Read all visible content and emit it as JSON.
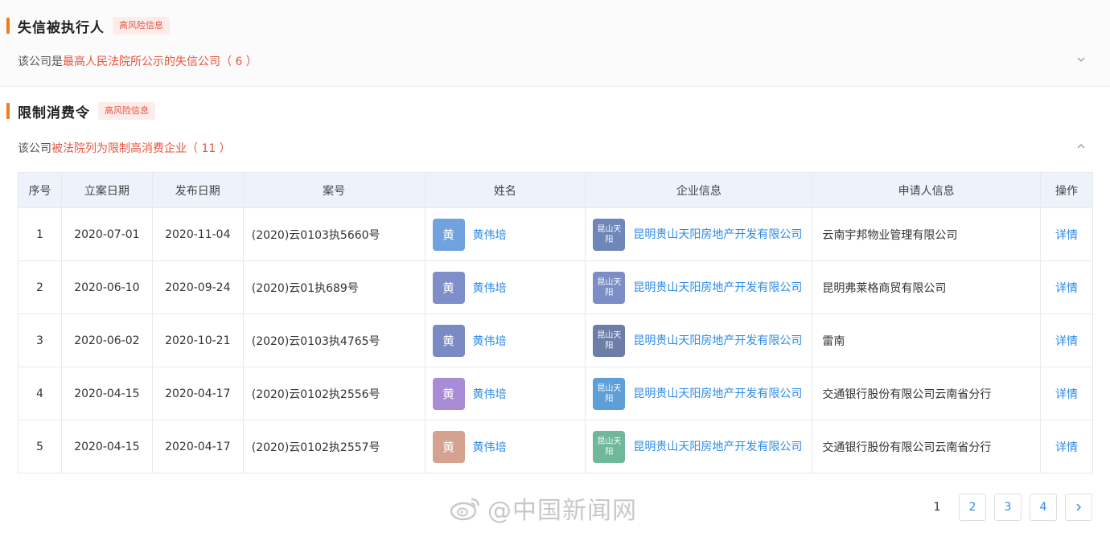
{
  "sections": {
    "dishonest": {
      "title": "失信被执行人",
      "risk_tag": "高风险信息",
      "desc_prefix": "该公司是",
      "desc_highlight": "最高人民法院所公示的失信公司",
      "desc_count": "（ 6 ）"
    },
    "restriction": {
      "title": "限制消费令",
      "risk_tag": "高风险信息",
      "desc_prefix": "该公司",
      "desc_highlight": "被法院列为限制高消费企业",
      "desc_count": "（ 11 ）"
    }
  },
  "table": {
    "headers": [
      "序号",
      "立案日期",
      "发布日期",
      "案号",
      "姓名",
      "企业信息",
      "申请人信息",
      "操作"
    ],
    "rows": [
      {
        "idx": "1",
        "filed": "2020-07-01",
        "published": "2020-11-04",
        "case_no": "(2020)云0103执5660号",
        "avatar_char": "黄",
        "avatar_color": "#6fa2de",
        "person": "黄伟培",
        "ent_avatar": "昆山天阳",
        "ent_color": "#6f86b8",
        "enterprise": "昆明贵山天阳房地产开发有限公司",
        "applicant": "云南宇邦物业管理有限公司",
        "action": "详情"
      },
      {
        "idx": "2",
        "filed": "2020-06-10",
        "published": "2020-09-24",
        "case_no": "(2020)云01执689号",
        "avatar_char": "黄",
        "avatar_color": "#7e8ec8",
        "person": "黄伟培",
        "ent_avatar": "昆山天阳",
        "ent_color": "#7b8ec6",
        "enterprise": "昆明贵山天阳房地产开发有限公司",
        "applicant": "昆明弗莱格商贸有限公司",
        "action": "详情"
      },
      {
        "idx": "3",
        "filed": "2020-06-02",
        "published": "2020-10-21",
        "case_no": "(2020)云0103执4765号",
        "avatar_char": "黄",
        "avatar_color": "#7a8bc4",
        "person": "黄伟培",
        "ent_avatar": "昆山天阳",
        "ent_color": "#6c7ea8",
        "enterprise": "昆明贵山天阳房地产开发有限公司",
        "applicant": "雷南",
        "action": "详情"
      },
      {
        "idx": "4",
        "filed": "2020-04-15",
        "published": "2020-04-17",
        "case_no": "(2020)云0102执2556号",
        "avatar_char": "黄",
        "avatar_color": "#a98bd6",
        "person": "黄伟培",
        "ent_avatar": "昆山天阳",
        "ent_color": "#5d9fd6",
        "enterprise": "昆明贵山天阳房地产开发有限公司",
        "applicant": "交通银行股份有限公司云南省分行",
        "action": "详情"
      },
      {
        "idx": "5",
        "filed": "2020-04-15",
        "published": "2020-04-17",
        "case_no": "(2020)云0102执2557号",
        "avatar_char": "黄",
        "avatar_color": "#d4a28e",
        "person": "黄伟培",
        "ent_avatar": "昆山天阳",
        "ent_color": "#6fb89a",
        "enterprise": "昆明贵山天阳房地产开发有限公司",
        "applicant": "交通银行股份有限公司云南省分行",
        "action": "详情"
      }
    ]
  },
  "watermark": "@中国新闻网",
  "pagination": {
    "pages": [
      "1",
      "2",
      "3",
      "4"
    ],
    "current": "1",
    "next": "›"
  },
  "icons": {
    "chevron_down": "chevron-down-icon",
    "chevron_up": "chevron-up-icon",
    "weibo": "weibo-icon"
  }
}
